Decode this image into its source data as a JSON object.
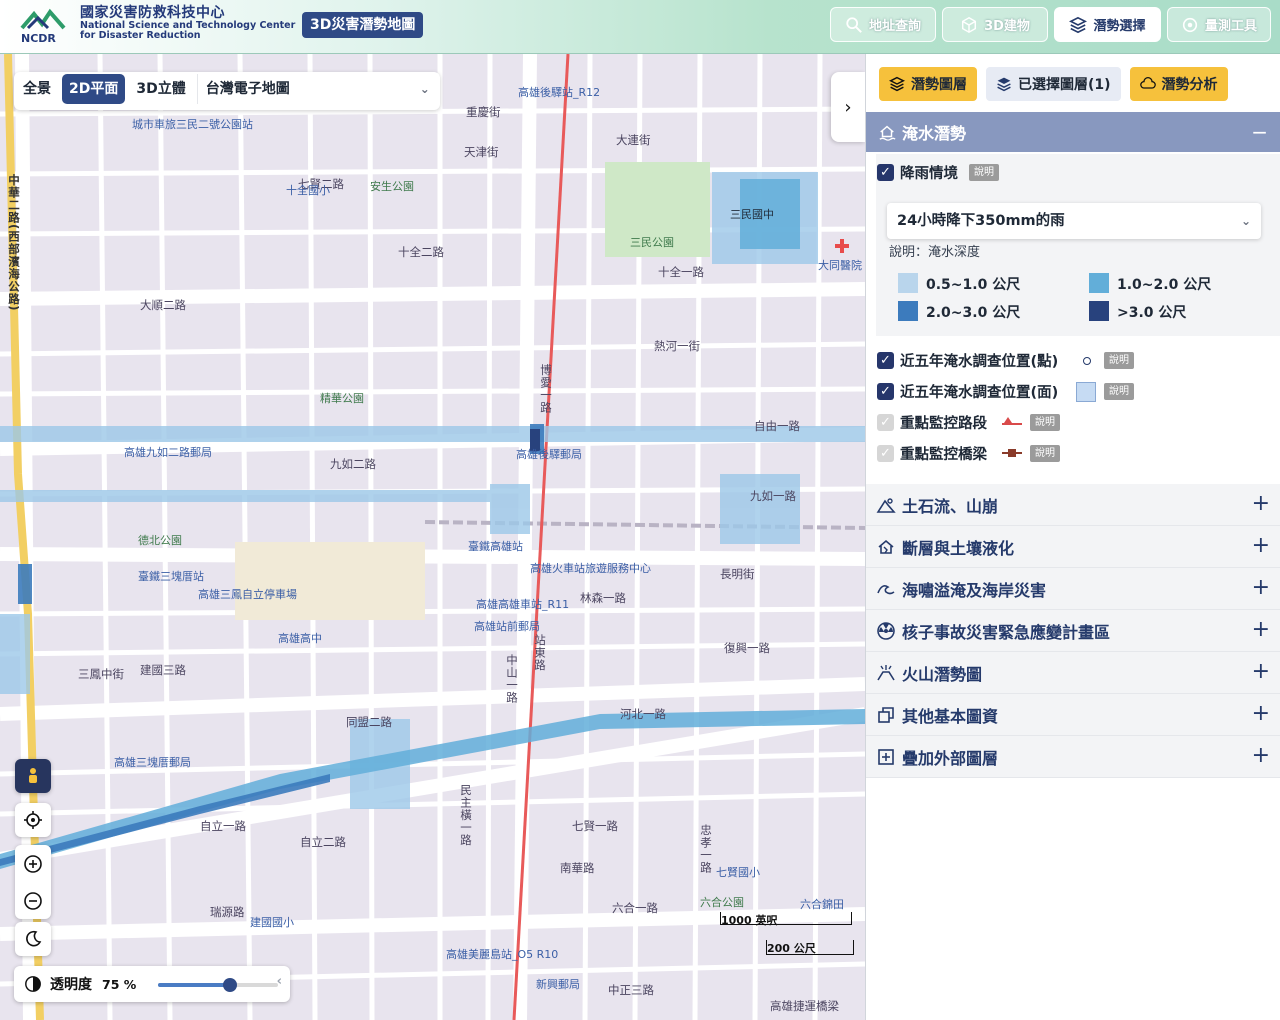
{
  "header": {
    "org_zh": "國家災害防救科技中心",
    "org_en_1": "National Science and Technology Center",
    "org_en_2": "for Disaster Reduction",
    "logo_text": "NCDR",
    "app_title": "3D災害潛勢地圖",
    "buttons": [
      {
        "label": "地址查詢",
        "icon": "search-icon"
      },
      {
        "label": "3D建物",
        "icon": "cube-icon"
      },
      {
        "label": "潛勢選擇",
        "icon": "layers-icon",
        "active": true
      },
      {
        "label": "量測工具",
        "icon": "measure-icon"
      }
    ]
  },
  "map": {
    "view_tabs": [
      "全景",
      "2D平面",
      "3D立體"
    ],
    "active_view": "2D平面",
    "basemap": "台灣電子地圖",
    "opacity_label": "透明度",
    "opacity_value": "75 %",
    "opacity_fraction": 0.75,
    "scale_ft": "1000 英呎",
    "scale_m": "200 公尺",
    "labels": {
      "roads": [
        "中華二路(西部濱海公路)",
        "中山一路",
        "博愛一路",
        "九如二路",
        "十全一路",
        "自由一路",
        "大順二路",
        "建國三路",
        "七賢一路",
        "林森一路",
        "南華路",
        "民主橫一路",
        "瑞源路",
        "六合一路",
        "中正三路",
        "忠孝一路",
        "大連街",
        "熱河一街",
        "重慶街",
        "天津街",
        "自立一路",
        "自立二路",
        "三鳳中街",
        "同盟二路",
        "河北一路",
        "高雄捷運橋梁",
        "長明街",
        "十全二路",
        "九如一路",
        "七賢二路",
        "復興一路"
      ],
      "pois": [
        "高雄後驛站_R12",
        "城市車旅三民二號公園站",
        "十全國小",
        "安生公園",
        "三民國中",
        "三民公園",
        "大同醫院",
        "精華公園",
        "高雄後驛郵局",
        "高雄九如二路郵局",
        "臺鐵高雄站",
        "高雄火車站旅遊服務中心",
        "德北公園",
        "臺鐵三塊厝站",
        "高雄三鳳自立停車場",
        "高雄高中",
        "高雄高雄車站_R11",
        "高雄站前郵局",
        "站東路",
        "高雄三塊厝郵局",
        "七賢國小",
        "建國國小",
        "六合公園",
        "高雄美麗島站_O5 R10",
        "新興郵局",
        "六合錦田"
      ]
    }
  },
  "panel": {
    "tabs": [
      {
        "label": "潛勢圖層",
        "style": "orange",
        "icon": "layers-icon"
      },
      {
        "label": "已選擇圖層(1)",
        "style": "blue",
        "icon": "stack-check-icon"
      },
      {
        "label": "潛勢分析",
        "style": "orange",
        "icon": "cloud-icon"
      }
    ],
    "active_section": {
      "title": "淹水潛勢",
      "toggle": "−"
    },
    "rain": {
      "checkbox_label": "降雨情境",
      "info": "說明",
      "selected": "24小時降下350mm的雨",
      "desc": "說明：淹水深度",
      "legend": [
        {
          "label": "0.5~1.0 公尺",
          "color": "#b9d5ec"
        },
        {
          "label": "1.0~2.0 公尺",
          "color": "#62aed9"
        },
        {
          "label": "2.0~3.0 公尺",
          "color": "#3c7bbd"
        },
        {
          "label": ">3.0 公尺",
          "color": "#28427d"
        }
      ]
    },
    "layers": [
      {
        "label": "近五年淹水調查位置(點)",
        "checked": true,
        "info": "說明"
      },
      {
        "label": "近五年淹水調查位置(面)",
        "checked": true,
        "info": "說明"
      },
      {
        "label": "重點監控路段",
        "checked": false,
        "info": "說明"
      },
      {
        "label": "重點監控橋梁",
        "checked": false,
        "info": "說明"
      }
    ],
    "sections": [
      {
        "title": "土石流、山崩",
        "icon": "landslide-icon"
      },
      {
        "title": "斷層與土壤液化",
        "icon": "earthquake-icon"
      },
      {
        "title": "海嘯溢淹及海岸災害",
        "icon": "wave-icon"
      },
      {
        "title": "核子事故災害緊急應變計畫區",
        "icon": "radiation-icon"
      },
      {
        "title": "火山潛勢圖",
        "icon": "volcano-icon"
      },
      {
        "title": "其他基本圖資",
        "icon": "map-layers-icon"
      },
      {
        "title": "疊加外部圖層",
        "icon": "add-layer-icon"
      }
    ],
    "plus": "+"
  }
}
